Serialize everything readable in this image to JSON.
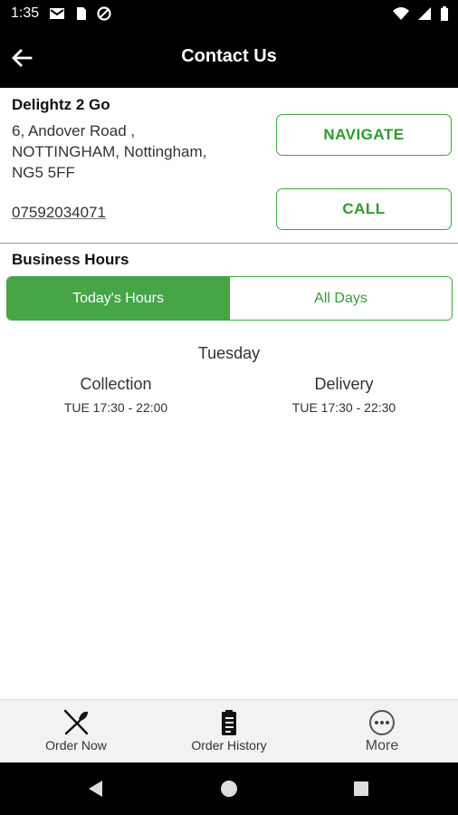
{
  "status_bar": {
    "time": "1:35",
    "icons_left": [
      "gmail-icon",
      "sim-icon",
      "data-saver-icon"
    ],
    "icons_right": [
      "wifi-icon",
      "signal-icon",
      "battery-icon"
    ]
  },
  "app_bar": {
    "title": "Contact Us",
    "back_icon": "arrow-left-icon"
  },
  "business": {
    "name": "Delightz 2 Go",
    "address_line1": "6, Andover Road ,",
    "address_line2": "NOTTINGHAM, Nottingham,",
    "address_line3": "NG5 5FF",
    "phone": "07592034071",
    "navigate_label": "NAVIGATE",
    "call_label": "CALL"
  },
  "hours": {
    "title": "Business Hours",
    "tabs": [
      {
        "label": "Today's Hours",
        "active": true
      },
      {
        "label": "All Days",
        "active": false
      }
    ],
    "day": "Tuesday",
    "collection_label": "Collection",
    "collection_time": "TUE 17:30 - 22:00",
    "delivery_label": "Delivery",
    "delivery_time": "TUE 17:30 - 22:30"
  },
  "bottom_nav": {
    "items": [
      {
        "label": "Order Now",
        "icon": "fork-knife-icon"
      },
      {
        "label": "Order History",
        "icon": "clipboard-icon"
      },
      {
        "label": "More",
        "icon": "more-circle-icon"
      }
    ]
  },
  "colors": {
    "accent_green": "#46a546",
    "appbar_bg": "#000000"
  }
}
